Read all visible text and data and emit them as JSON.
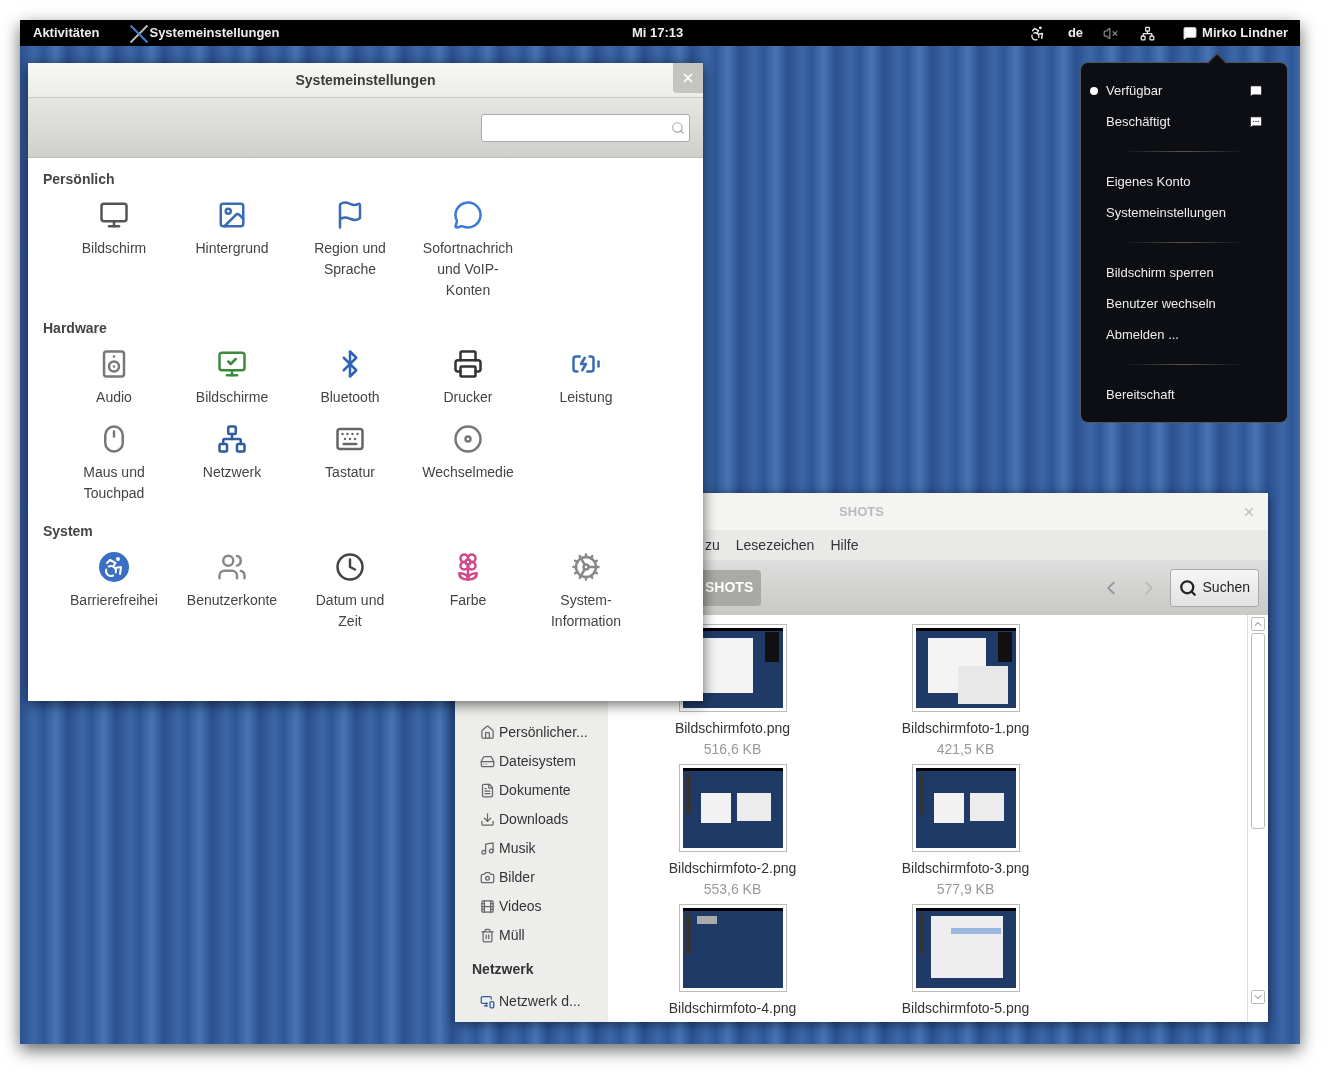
{
  "top_bar": {
    "activities": "Aktivitäten",
    "app_name": "Systemeinstellungen",
    "clock": "Mi 17:13",
    "keyboard_layout": "de",
    "user": "Mirko Lindner"
  },
  "settings_window": {
    "title": "Systemeinstellungen",
    "sections": [
      {
        "title": "Persönlich",
        "items": [
          {
            "lines": [
              "Bildschirm"
            ]
          },
          {
            "lines": [
              "Hintergrund"
            ]
          },
          {
            "lines": [
              "Region und",
              "Sprache"
            ]
          },
          {
            "lines": [
              "Sofortnachrich",
              "und VoIP-",
              "Konten"
            ]
          }
        ]
      },
      {
        "title": "Hardware",
        "items": [
          {
            "lines": [
              "Audio"
            ]
          },
          {
            "lines": [
              "Bildschirme"
            ]
          },
          {
            "lines": [
              "Bluetooth"
            ]
          },
          {
            "lines": [
              "Drucker"
            ]
          },
          {
            "lines": [
              "Leistung"
            ]
          },
          {
            "lines": [
              "Maus und",
              "Touchpad"
            ]
          },
          {
            "lines": [
              "Netzwerk"
            ]
          },
          {
            "lines": [
              "Tastatur"
            ]
          },
          {
            "lines": [
              "Wechselmedie"
            ]
          }
        ]
      },
      {
        "title": "System",
        "items": [
          {
            "lines": [
              "Barrierefreihei"
            ]
          },
          {
            "lines": [
              "Benutzerkonte"
            ]
          },
          {
            "lines": [
              "Datum und",
              "Zeit"
            ]
          },
          {
            "lines": [
              "Farbe"
            ]
          },
          {
            "lines": [
              "System-",
              "Information"
            ]
          }
        ]
      }
    ]
  },
  "user_menu": {
    "groups": [
      [
        {
          "kind": "status",
          "label": "Verfügbar",
          "selected": true
        },
        {
          "kind": "status",
          "label": "Beschäftigt",
          "selected": false
        }
      ],
      [
        {
          "kind": "action",
          "label": "Eigenes Konto"
        },
        {
          "kind": "action",
          "label": "Systemeinstellungen"
        }
      ],
      [
        {
          "kind": "action",
          "label": "Bildschirm sperren"
        },
        {
          "kind": "action",
          "label": "Benutzer wechseln"
        },
        {
          "kind": "action",
          "label": "Abmelden ..."
        }
      ],
      [
        {
          "kind": "action",
          "label": "Bereitschaft"
        }
      ]
    ]
  },
  "file_manager": {
    "title": "SHOTS",
    "menu": [
      "zu",
      "Lesezeichen",
      "Hilfe"
    ],
    "path_button": "SHOTS",
    "search_button": "Suchen",
    "sidebar": {
      "places": [
        "Persönlicher...",
        "Dateisystem",
        "Dokumente",
        "Downloads",
        "Musik",
        "Bilder",
        "Videos",
        "Müll"
      ],
      "network_title": "Netzwerk",
      "network": [
        "Netzwerk d..."
      ]
    },
    "files": [
      {
        "name": "Bildschirmfoto.png",
        "size": "516,6 KB"
      },
      {
        "name": "Bildschirmfoto-1.png",
        "size": "421,5 KB"
      },
      {
        "name": "Bildschirmfoto-2.png",
        "size": "553,6 KB"
      },
      {
        "name": "Bildschirmfoto-3.png",
        "size": "577,9 KB"
      },
      {
        "name": "Bildschirmfoto-4.png"
      },
      {
        "name": "Bildschirmfoto-5.png"
      }
    ]
  }
}
